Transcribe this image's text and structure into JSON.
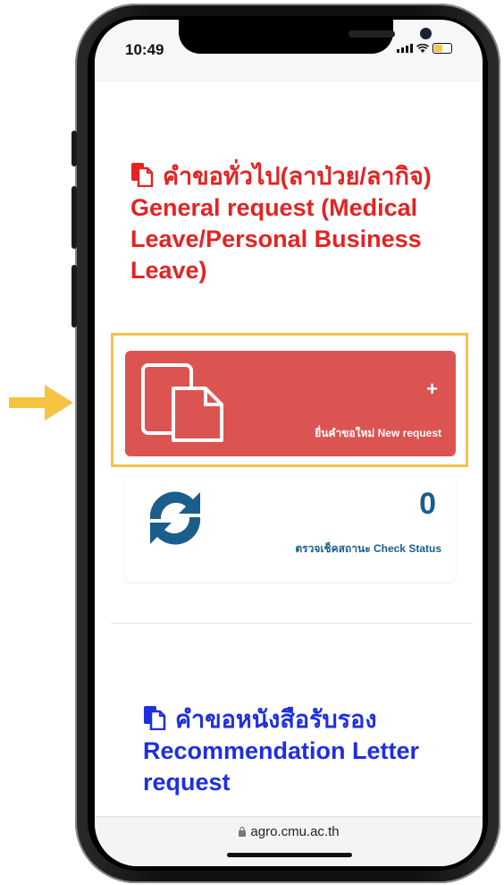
{
  "status_bar": {
    "time": "10:49"
  },
  "section1": {
    "title": "คำขอทั่วไป(ลาป่วย/ลากิจ) General request (Medical Leave/Personal Business Leave)",
    "new_request": {
      "plus": "+",
      "label": "ยื่นคำขอใหม่ New request"
    },
    "check_status": {
      "count": "0",
      "label": "ตรวจเช็คสถานะ Check Status"
    }
  },
  "section2": {
    "title": "คำขอหนังสือรับรอง Recommendation Letter request"
  },
  "browser": {
    "url": "agro.cmu.ac.th"
  },
  "colors": {
    "red_title": "#e32323",
    "button_red": "#db5452",
    "blue_title": "#1e2fe0",
    "status_blue": "#1b5d8b",
    "highlight": "#f5c342"
  }
}
